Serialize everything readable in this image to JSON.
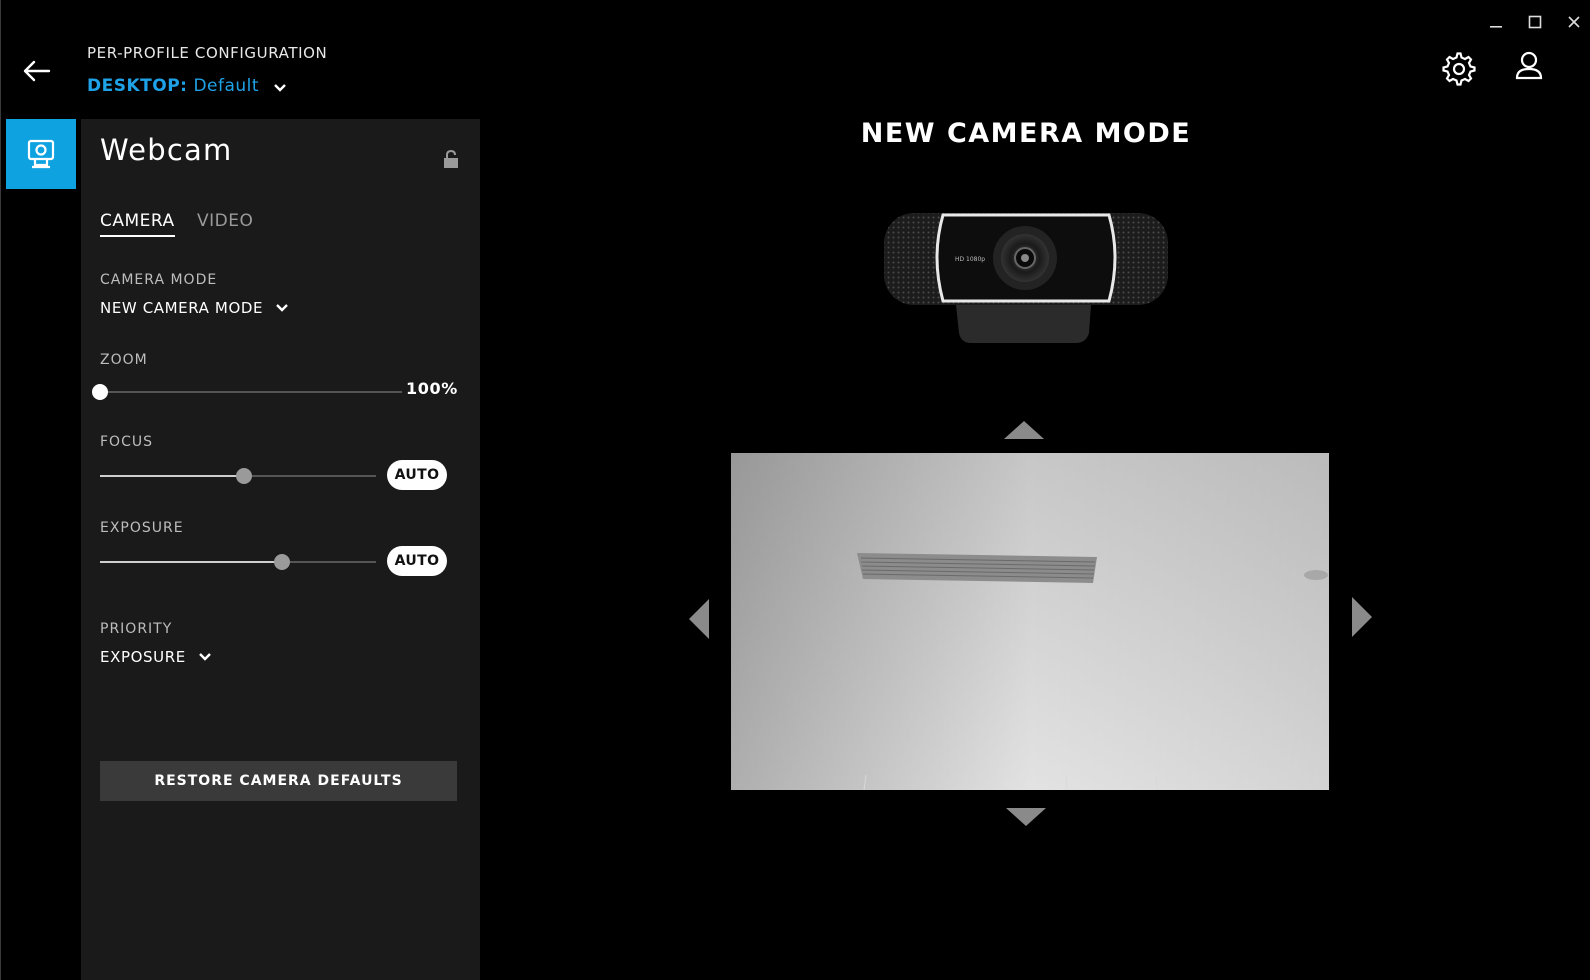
{
  "window": {
    "minimize_icon": "minimize-icon",
    "maximize_icon": "maximize-icon",
    "close_icon": "close-icon"
  },
  "header": {
    "subtitle": "PER-PROFILE CONFIGURATION",
    "profile_key": "DESKTOP:",
    "profile_value": "Default",
    "accent_color": "#1fa3e8"
  },
  "device": {
    "icon": "webcam-icon",
    "tile_color": "#0fa2e0"
  },
  "panel": {
    "title": "Webcam",
    "tabs": [
      {
        "label": "CAMERA",
        "active": true
      },
      {
        "label": "VIDEO",
        "active": false
      }
    ],
    "camera_mode": {
      "label": "CAMERA MODE",
      "value": "NEW CAMERA MODE"
    },
    "zoom": {
      "label": "ZOOM",
      "value_text": "100%",
      "level": 0.0
    },
    "focus": {
      "label": "FOCUS",
      "level": 0.52,
      "auto_label": "AUTO"
    },
    "exposure": {
      "label": "EXPOSURE",
      "level": 0.66,
      "auto_label": "AUTO"
    },
    "priority": {
      "label": "PRIORITY",
      "value": "EXPOSURE"
    },
    "restore_label": "RESTORE CAMERA DEFAULTS"
  },
  "main": {
    "heading": "NEW CAMERA MODE",
    "camera_badge": "HD 1080p"
  }
}
